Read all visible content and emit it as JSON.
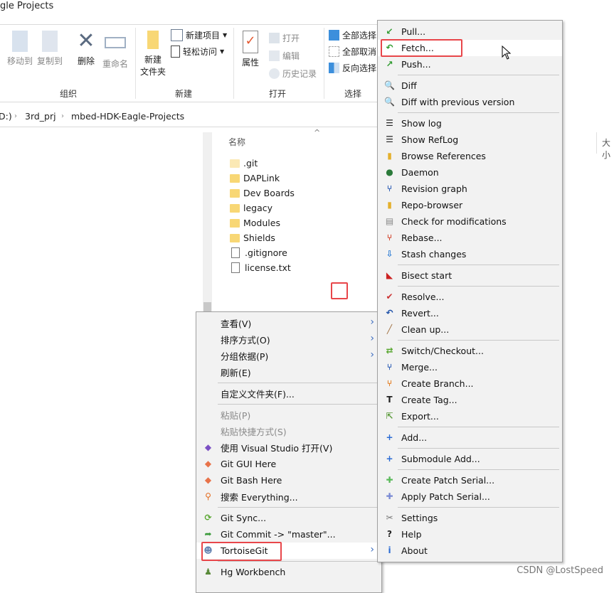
{
  "window": {
    "title_fragment": "gle Projects"
  },
  "ribbon": {
    "organize": {
      "move_to": "移动到",
      "copy_to": "复制到",
      "delete": "删除",
      "rename": "重命名",
      "label": "组织"
    },
    "new": {
      "new_folder_line1": "新建",
      "new_folder_line2": "文件夹",
      "new_item": "新建项目",
      "easy_access": "轻松访问",
      "label": "新建"
    },
    "open": {
      "properties": "属性",
      "open": "打开",
      "edit": "编辑",
      "history": "历史记录",
      "label": "打开"
    },
    "select": {
      "select_all": "全部选择",
      "select_none": "全部取消",
      "invert": "反向选择",
      "label": "选择"
    }
  },
  "address_bar": {
    "crumbs": [
      "D:)",
      "3rd_prj",
      "mbed-HDK-Eagle-Projects"
    ]
  },
  "file_list": {
    "column_name": "名称",
    "column_size": "大小",
    "items": [
      {
        "name": ".git",
        "type": "folder-hidden"
      },
      {
        "name": "DAPLink",
        "type": "folder"
      },
      {
        "name": "Dev Boards",
        "type": "folder"
      },
      {
        "name": "legacy",
        "type": "folder"
      },
      {
        "name": "Modules",
        "type": "folder"
      },
      {
        "name": "Shields",
        "type": "folder"
      },
      {
        "name": ".gitignore",
        "type": "file"
      },
      {
        "name": "license.txt",
        "type": "file"
      }
    ]
  },
  "context_menu": {
    "items": [
      {
        "label": "查看(V)",
        "submenu": true
      },
      {
        "label": "排序方式(O)",
        "submenu": true
      },
      {
        "label": "分组依据(P)",
        "submenu": true
      },
      {
        "label": "刷新(E)"
      },
      {
        "sep": true
      },
      {
        "label": "自定义文件夹(F)..."
      },
      {
        "sep": true
      },
      {
        "label": "粘贴(P)",
        "disabled": true
      },
      {
        "label": "粘贴快捷方式(S)",
        "disabled": true
      },
      {
        "label": "使用 Visual Studio 打开(V)",
        "icon": "visual-studio-icon"
      },
      {
        "label": "Git GUI Here",
        "icon": "git-gui-icon"
      },
      {
        "label": "Git Bash Here",
        "icon": "git-bash-icon"
      },
      {
        "label": "搜索 Everything...",
        "icon": "everything-search-icon"
      },
      {
        "sep": true
      },
      {
        "label": "Git Sync...",
        "icon": "git-sync-icon"
      },
      {
        "label": "Git Commit -> \"master\"...",
        "icon": "git-commit-icon"
      },
      {
        "label": "TortoiseGit",
        "icon": "tortoisegit-icon",
        "submenu": true,
        "highlighted": true
      },
      {
        "sep": true
      },
      {
        "label": "Hg Workbench",
        "icon": "hg-workbench-icon"
      }
    ]
  },
  "tortoisegit_menu": {
    "items": [
      {
        "label": "Pull...",
        "icon": "pull-icon"
      },
      {
        "label": "Fetch...",
        "icon": "fetch-icon",
        "highlighted": true
      },
      {
        "label": "Push...",
        "icon": "push-icon"
      },
      {
        "sep": true
      },
      {
        "label": "Diff",
        "icon": "diff-icon"
      },
      {
        "label": "Diff with previous version",
        "icon": "diff-previous-icon"
      },
      {
        "sep": true
      },
      {
        "label": "Show log",
        "icon": "show-log-icon"
      },
      {
        "label": "Show RefLog",
        "icon": "show-reflog-icon"
      },
      {
        "label": "Browse References",
        "icon": "browse-references-icon"
      },
      {
        "label": "Daemon",
        "icon": "daemon-icon"
      },
      {
        "label": "Revision graph",
        "icon": "revision-graph-icon"
      },
      {
        "label": "Repo-browser",
        "icon": "repo-browser-icon"
      },
      {
        "label": "Check for modifications",
        "icon": "check-modifications-icon"
      },
      {
        "label": "Rebase...",
        "icon": "rebase-icon"
      },
      {
        "label": "Stash changes",
        "icon": "stash-icon"
      },
      {
        "sep": true
      },
      {
        "label": "Bisect start",
        "icon": "bisect-icon"
      },
      {
        "sep": true
      },
      {
        "label": "Resolve...",
        "icon": "resolve-icon"
      },
      {
        "label": "Revert...",
        "icon": "revert-icon"
      },
      {
        "label": "Clean up...",
        "icon": "cleanup-icon"
      },
      {
        "sep": true
      },
      {
        "label": "Switch/Checkout...",
        "icon": "switch-checkout-icon"
      },
      {
        "label": "Merge...",
        "icon": "merge-icon"
      },
      {
        "label": "Create Branch...",
        "icon": "create-branch-icon"
      },
      {
        "label": "Create Tag...",
        "icon": "create-tag-icon"
      },
      {
        "label": "Export...",
        "icon": "export-icon"
      },
      {
        "sep": true
      },
      {
        "label": "Add...",
        "icon": "add-icon"
      },
      {
        "sep": true
      },
      {
        "label": "Submodule Add...",
        "icon": "submodule-add-icon"
      },
      {
        "sep": true
      },
      {
        "label": "Create Patch Serial...",
        "icon": "create-patch-icon"
      },
      {
        "label": "Apply Patch Serial...",
        "icon": "apply-patch-icon"
      },
      {
        "sep": true
      },
      {
        "label": "Settings",
        "icon": "settings-icon"
      },
      {
        "label": "Help",
        "icon": "help-icon"
      },
      {
        "label": "About",
        "icon": "about-icon"
      }
    ]
  },
  "watermark": "CSDN @LostSpeed",
  "colors": {
    "highlight_box": "#e8464a",
    "menu_bg": "#f2f2f2",
    "menu_highlight": "#ffffff",
    "submenu_arrow": "#3a6bbf"
  }
}
